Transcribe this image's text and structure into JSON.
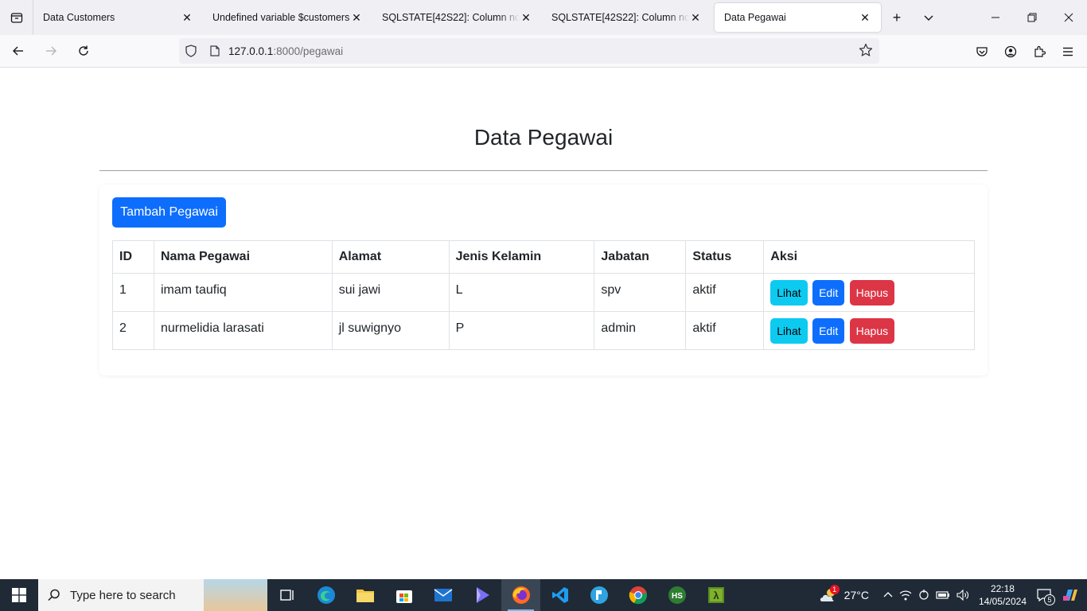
{
  "browser": {
    "tabs": [
      {
        "label": "Data Customers",
        "active": false
      },
      {
        "label": "Undefined variable $customers",
        "active": false
      },
      {
        "label": "SQLSTATE[42S22]: Column not fou",
        "active": false
      },
      {
        "label": "SQLSTATE[42S22]: Column not fou",
        "active": false
      },
      {
        "label": "Data Pegawai",
        "active": true
      }
    ],
    "url_host": "127.0.0.1",
    "url_rest": ":8000/pegawai"
  },
  "page": {
    "title": "Data Pegawai",
    "add_button": "Tambah Pegawai",
    "table": {
      "headers": [
        "ID",
        "Nama Pegawai",
        "Alamat",
        "Jenis Kelamin",
        "Jabatan",
        "Status",
        "Aksi"
      ],
      "rows": [
        {
          "id": "1",
          "nama": "imam taufiq",
          "alamat": "sui jawi",
          "jk": "L",
          "jabatan": "spv",
          "status": "aktif"
        },
        {
          "id": "2",
          "nama": "nurmelidia larasati",
          "alamat": "jl suwignyo",
          "jk": "P",
          "jabatan": "admin",
          "status": "aktif"
        }
      ],
      "actions": {
        "view": "Lihat",
        "edit": "Edit",
        "delete": "Hapus"
      }
    }
  },
  "taskbar": {
    "search_placeholder": "Type here to search",
    "weather": "27°C",
    "time": "22:18",
    "date": "14/05/2024",
    "notification_count": "5",
    "weather_badge": "1"
  },
  "colors": {
    "primary": "#0d6efd",
    "info": "#0dcaf0",
    "danger": "#dc3545"
  }
}
